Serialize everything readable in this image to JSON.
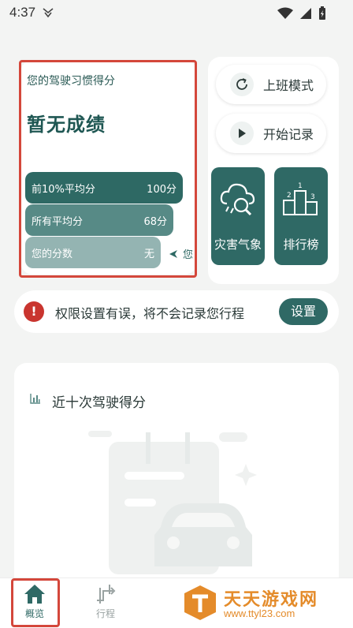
{
  "status_bar": {
    "time": "4:37"
  },
  "score_card": {
    "title": "您的驾驶习惯得分",
    "value": "暂无成绩",
    "bars": [
      {
        "label": "前10%平均分",
        "value": "100分"
      },
      {
        "label": "所有平均分",
        "value": "68分"
      },
      {
        "label": "您的分数",
        "value": "无"
      }
    ],
    "you_label": "您"
  },
  "actions": {
    "commute_mode": "上班模式",
    "start_record": "开始记录"
  },
  "tiles": {
    "weather": "灾害气象",
    "ranking": "排行榜"
  },
  "warning": {
    "icon": "!",
    "text": "权限设置有误，将不会记录您行程",
    "button": "设置"
  },
  "history": {
    "title": "近十次驾驶得分"
  },
  "nav": {
    "home": "概览",
    "trips": "行程"
  },
  "watermark": {
    "name": "天天游戏网",
    "url": "www.ttyl23.com"
  },
  "colors": {
    "accent": "#2f6965",
    "warning": "#c9352f",
    "highlight_outline": "#d4473b"
  }
}
